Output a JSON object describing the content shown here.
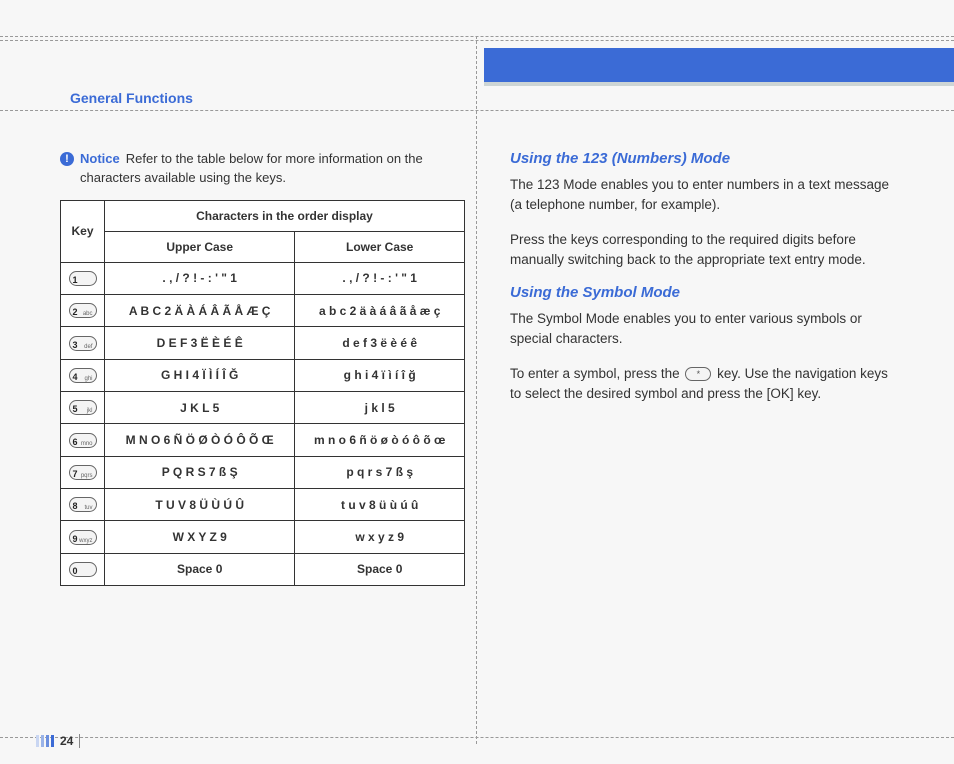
{
  "header": {
    "section_title": "General Functions"
  },
  "notice": {
    "label": "Notice",
    "text": "Refer to the table below for more information on the characters available using the keys."
  },
  "table": {
    "head_key": "Key",
    "head_chars": "Characters in the order display",
    "head_upper": "Upper Case",
    "head_lower": "Lower Case",
    "rows": [
      {
        "key_num": "1",
        "key_letters": "",
        "upper": ". , / ? ! - : ' \" 1",
        "lower": ". , / ? ! - : ' \" 1"
      },
      {
        "key_num": "2",
        "key_letters": "abc",
        "upper": "A B C 2 Ä À Á Â Ã Å Æ Ç",
        "lower": "a b c 2 ä à á â ã å æ ç"
      },
      {
        "key_num": "3",
        "key_letters": "def",
        "upper": "D E F 3 Ë È É Ê",
        "lower": "d e f 3 ë è é ê"
      },
      {
        "key_num": "4",
        "key_letters": "ghi",
        "upper": "G H I 4 Ï Ì Í Î Ğ",
        "lower": "g h i 4 ï ì í î ğ"
      },
      {
        "key_num": "5",
        "key_letters": "jkl",
        "upper": "J K L 5",
        "lower": "j k l 5"
      },
      {
        "key_num": "6",
        "key_letters": "mno",
        "upper": "M N O 6 Ñ Ö Ø Ò Ó Ô Õ Œ",
        "lower": "m n o 6 ñ ö ø ò ó ô õ œ"
      },
      {
        "key_num": "7",
        "key_letters": "pqrs",
        "upper": "P Q R S 7 ß Ş",
        "lower": "p q r s 7 ß ş"
      },
      {
        "key_num": "8",
        "key_letters": "tuv",
        "upper": "T U V 8 Ü Ù Ú Û",
        "lower": "t u v 8 ü ù ú û"
      },
      {
        "key_num": "9",
        "key_letters": "wxyz",
        "upper": "W X Y Z 9",
        "lower": "w x y z 9"
      },
      {
        "key_num": "0",
        "key_letters": "",
        "upper": "Space 0",
        "lower": "Space 0"
      }
    ]
  },
  "right": {
    "h1": "Using the 123 (Numbers) Mode",
    "p1": "The 123 Mode enables you to enter numbers in a text message (a telephone number, for example).",
    "p2": "Press the keys corresponding to the required digits before manually switching back to the appropriate text entry mode.",
    "h2": "Using the Symbol Mode",
    "p3": "The Symbol Mode enables you to enter various symbols or special characters.",
    "p4a": "To enter a symbol, press the ",
    "p4b": " key. Use the navigation keys to select the desired symbol and press the [OK] key.",
    "star_key_label": "*"
  },
  "footer": {
    "page_number": "24"
  }
}
